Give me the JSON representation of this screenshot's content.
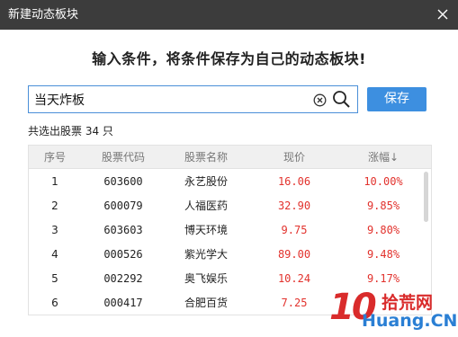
{
  "window": {
    "title": "新建动态板块",
    "close_icon": "close-icon"
  },
  "headline": "输入条件，将条件保存为自己的动态板块!",
  "search": {
    "value": "当天炸板",
    "clear_icon": "clear-icon",
    "search_icon": "search-icon"
  },
  "save_label": "保存",
  "result_count": "共选出股票 34 只",
  "table": {
    "columns": [
      "序号",
      "股票代码",
      "股票名称",
      "现价",
      "涨幅↓"
    ],
    "rows": [
      {
        "no": "1",
        "code": "603600",
        "name": "永艺股份",
        "price": "16.06",
        "change": "10.00%"
      },
      {
        "no": "2",
        "code": "600079",
        "name": "人福医药",
        "price": "32.90",
        "change": "9.85%"
      },
      {
        "no": "3",
        "code": "603603",
        "name": "博天环境",
        "price": "9.75",
        "change": "9.80%"
      },
      {
        "no": "4",
        "code": "000526",
        "name": "紫光学大",
        "price": "89.00",
        "change": "9.48%"
      },
      {
        "no": "5",
        "code": "002292",
        "name": "奥飞娱乐",
        "price": "10.24",
        "change": "9.17%"
      },
      {
        "no": "6",
        "code": "000417",
        "name": "合肥百货",
        "price": "7.25",
        "change": ""
      }
    ]
  },
  "watermark": {
    "number": "10",
    "chinese": "拾荒网",
    "url": "Huang.CN"
  },
  "colors": {
    "titlebar": "#3c3c3c",
    "accent_blue": "#3d8fe0",
    "up_red": "#e2322d"
  }
}
